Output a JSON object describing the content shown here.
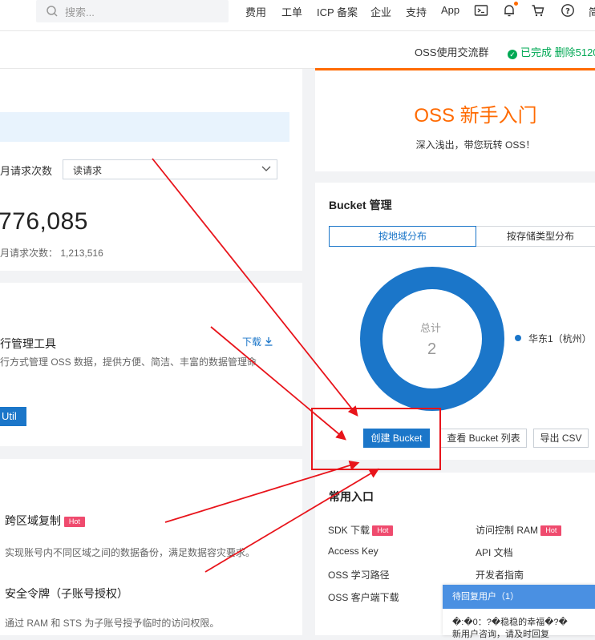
{
  "topnav": {
    "search_placeholder": "搜索...",
    "items": [
      "费用",
      "工单",
      "ICP 备案",
      "企业",
      "支持",
      "App"
    ]
  },
  "subbar": {
    "group": "OSS使用交流群",
    "status": "已完成 删除5120"
  },
  "requests": {
    "label": "月请求次数",
    "select_value": "读请求",
    "big_number": "776,085",
    "last_month_label": "月请求次数：",
    "last_month_value": "1,213,516"
  },
  "tool": {
    "title": "行管理工具",
    "download": "下载",
    "desc": "行方式管理 OSS 数据，提供方便、简洁、丰富的数据管理命",
    "button": "Util"
  },
  "features": [
    {
      "title": "跨区域复制",
      "badge": "Hot",
      "desc": "实现账号内不同区域之间的数据备份，满足数据容灾要求。"
    },
    {
      "title": "安全令牌（子账号授权）",
      "badge": "",
      "desc": "通过 RAM 和 STS 为子账号授予临时的访问权限。"
    }
  ],
  "oss_intro": {
    "title": "OSS 新手入门",
    "subtitle": "深入浅出，带您玩转 OSS！"
  },
  "bucket": {
    "title": "Bucket 管理",
    "tabs": [
      "按地域分布",
      "按存储类型分布"
    ],
    "donut_label": "总计",
    "donut_value": "2",
    "legend": "华东1（杭州）",
    "buttons": [
      "创建 Bucket",
      "查看 Bucket 列表",
      "导出 CSV"
    ]
  },
  "entries": {
    "title": "常用入口",
    "hot": "Hot",
    "items": [
      "SDK 下载",
      "访问控制 RAM",
      "Access Key",
      "API 文档",
      "OSS 学习路径",
      "开发者指南",
      "OSS 客户端下载"
    ]
  },
  "chat": {
    "header": "待回复用户（1）",
    "line1": "�:�0：?�稳稳的幸福�?�",
    "line2": "新用户咨询，请及时回复"
  },
  "colors": {
    "accent": "#1b76c9",
    "brand_orange": "#ff6a00",
    "hot_badge": "#ef4b6e",
    "success": "#00a854",
    "annotation_red": "#e8141b"
  }
}
